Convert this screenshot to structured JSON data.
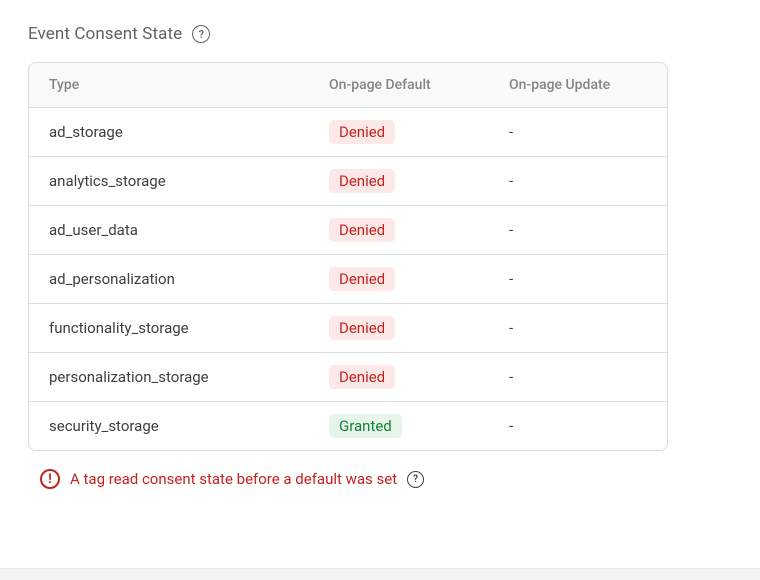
{
  "header": {
    "title": "Event Consent State"
  },
  "table": {
    "columns": {
      "type": "Type",
      "default": "On-page Default",
      "update": "On-page Update"
    },
    "rows": [
      {
        "type": "ad_storage",
        "default": "Denied",
        "default_status": "denied",
        "update": "-"
      },
      {
        "type": "analytics_storage",
        "default": "Denied",
        "default_status": "denied",
        "update": "-"
      },
      {
        "type": "ad_user_data",
        "default": "Denied",
        "default_status": "denied",
        "update": "-"
      },
      {
        "type": "ad_personalization",
        "default": "Denied",
        "default_status": "denied",
        "update": "-"
      },
      {
        "type": "functionality_storage",
        "default": "Denied",
        "default_status": "denied",
        "update": "-"
      },
      {
        "type": "personalization_storage",
        "default": "Denied",
        "default_status": "denied",
        "update": "-"
      },
      {
        "type": "security_storage",
        "default": "Granted",
        "default_status": "granted",
        "update": "-"
      }
    ]
  },
  "alert": {
    "text": "A tag read consent state before a default was set"
  }
}
